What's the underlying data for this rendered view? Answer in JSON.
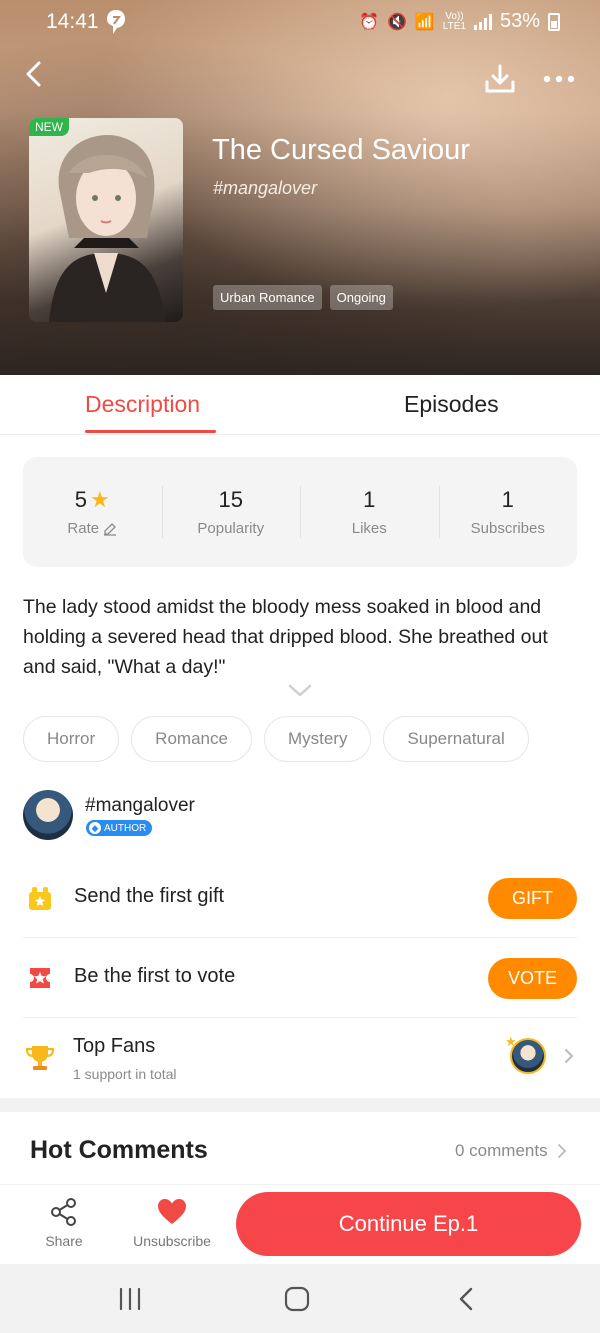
{
  "status_bar": {
    "time": "14:41",
    "volte_label": "Vo))",
    "lte_label": "LTE1",
    "battery": "53%"
  },
  "header": {
    "new_badge": "NEW",
    "title": "The Cursed Saviour",
    "author_tag": "#mangalover",
    "genres": [
      "Urban Romance",
      "Ongoing"
    ]
  },
  "tabs": [
    {
      "label": "Description",
      "active": true
    },
    {
      "label": "Episodes",
      "active": false
    }
  ],
  "stats": [
    {
      "value": "5",
      "label": "Rate"
    },
    {
      "value": "15",
      "label": "Popularity"
    },
    {
      "value": "1",
      "label": "Likes"
    },
    {
      "value": "1",
      "label": "Subscribes"
    }
  ],
  "description": "The lady stood amidst the bloody mess soaked in blood and holding a severed head that dripped blood. She breathed out and said, \"What a day!\"",
  "tags": [
    "Horror",
    "Romance",
    "Mystery",
    "Supernatural"
  ],
  "author": {
    "name": "#mangalover",
    "badge": "AUTHOR"
  },
  "actions": {
    "gift_label": "Send the first gift",
    "gift_button": "GIFT",
    "vote_label": "Be the first to vote",
    "vote_button": "VOTE"
  },
  "top_fans": {
    "title": "Top Fans",
    "subtitle": "1 support in total"
  },
  "comments": {
    "heading": "Hot Comments",
    "count": "0 comments"
  },
  "bottom_bar": {
    "share": "Share",
    "unsubscribe": "Unsubscribe",
    "continue": "Continue Ep.1"
  },
  "colors": {
    "accent_red": "#f04a45",
    "button_orange": "#ff8a00",
    "continue_red": "#f7464a",
    "star_yellow": "#f8b81c",
    "badge_green": "#2fb54b",
    "author_blue": "#2a8cf0"
  },
  "icons": [
    "notification-icon",
    "alarm-icon",
    "mute-icon",
    "wifi-icon",
    "signal-icon",
    "battery-icon",
    "back-icon",
    "download-icon",
    "more-icon",
    "star-icon",
    "edit-icon",
    "chevron-down-icon",
    "gift-icon",
    "vote-ticket-icon",
    "trophy-icon",
    "chevron-right-icon",
    "share-icon",
    "heart-icon",
    "recent-apps-icon",
    "home-icon",
    "nav-back-icon"
  ]
}
